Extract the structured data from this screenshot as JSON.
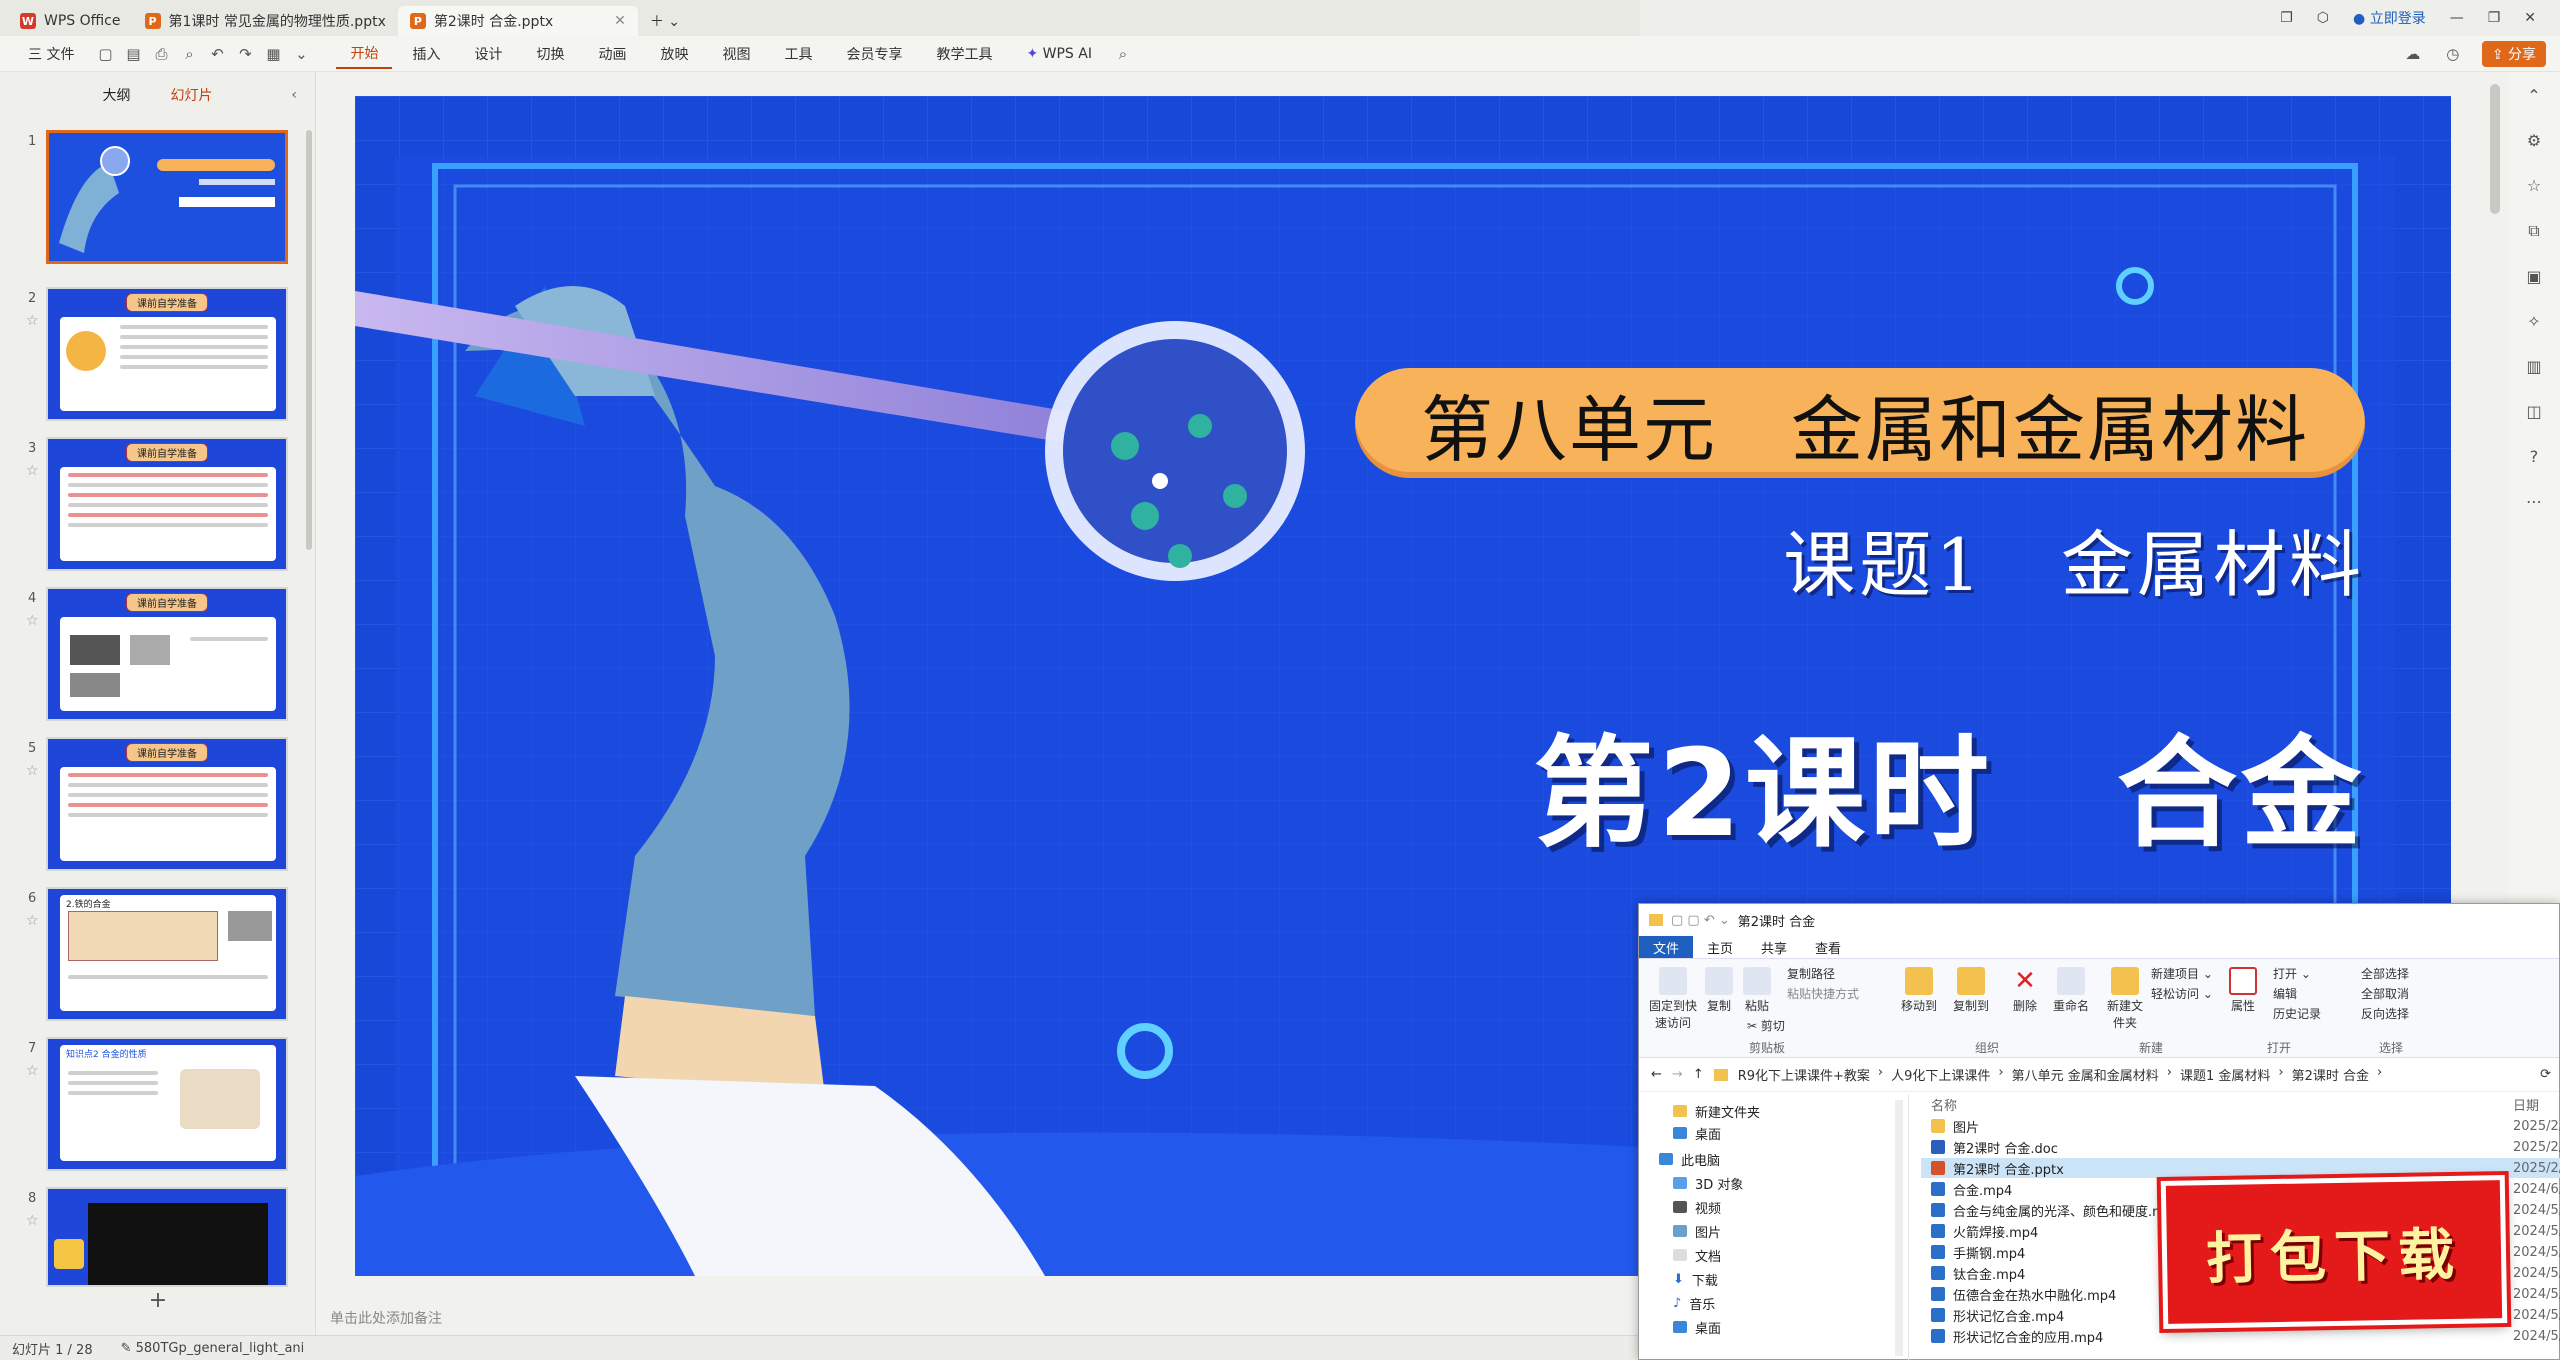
{
  "tabs": [
    {
      "label": "WPS Office",
      "badge": "W",
      "color": "#d23b2a"
    },
    {
      "label": "第1课时 常见金属的物理性质.pptx",
      "badge": "P",
      "color": "#e0681a"
    },
    {
      "label": "第2课时 合金.pptx",
      "badge": "P",
      "color": "#e0681a"
    }
  ],
  "window": {
    "login": "立即登录",
    "share": "分享"
  },
  "menu": {
    "file": "三 文件",
    "items": [
      "开始",
      "插入",
      "设计",
      "切换",
      "动画",
      "放映",
      "视图",
      "工具",
      "会员专享",
      "教学工具"
    ],
    "ai": "WPS AI"
  },
  "panel": {
    "tab_outline": "大纲",
    "tab_slides": "幻灯片",
    "add": "+"
  },
  "thumbs": [
    {
      "num": "1",
      "title": "第八单元 金属和金属材料"
    },
    {
      "num": "2",
      "title": "课前自学准备"
    },
    {
      "num": "3",
      "title": "课前自学准备"
    },
    {
      "num": "4",
      "title": "课前自学准备"
    },
    {
      "num": "5",
      "title": "课前自学准备"
    },
    {
      "num": "6",
      "title": "2.铁的合金"
    },
    {
      "num": "7",
      "title": "知识点2 合金的性质"
    },
    {
      "num": "8",
      "title": ""
    }
  ],
  "slide": {
    "unit_banner": "第八单元　金属和金属材料",
    "topic": "课题1　金属材料",
    "lesson": "第2课时　合金",
    "colors": {
      "bg": "#1848d8",
      "banner": "#f7b25a",
      "glove": "#6fa0c8"
    }
  },
  "notes": "单击此处添加备注",
  "status": {
    "slide": "幻灯片 1 / 28",
    "theme": "580TGp_general_light_ani"
  },
  "explorer": {
    "title": "第2课时 合金",
    "ribbon_tabs": [
      "文件",
      "主页",
      "共享",
      "查看"
    ],
    "ribbon": {
      "pin": "固定到快速访问",
      "copy": "复制",
      "paste": "粘贴",
      "copy_path": "复制路径",
      "paste_shortcut": "粘贴快捷方式",
      "cut": "剪切",
      "move_to": "移动到",
      "copy_to": "复制到",
      "delete": "删除",
      "rename": "重命名",
      "new_folder": "新建文件夹",
      "new_item": "新建项目",
      "easy_access": "轻松访问",
      "properties": "属性",
      "open": "打开",
      "edit": "编辑",
      "history": "历史记录",
      "select_all": "全部选择",
      "select_none": "全部取消",
      "invert": "反向选择",
      "groups": [
        "剪贴板",
        "组织",
        "新建",
        "打开",
        "选择"
      ]
    },
    "breadcrumb": [
      "R9化下上课课件+教案",
      "人9化下上课课件",
      "第八单元 金属和金属材料",
      "课题1 金属材料",
      "第2课时 合金"
    ],
    "nav": [
      "新建文件夹",
      "桌面",
      "此电脑",
      "3D 对象",
      "视频",
      "图片",
      "文档",
      "下载",
      "音乐",
      "桌面"
    ],
    "columns": {
      "name": "名称",
      "date": "日期"
    },
    "files": [
      {
        "name": "图片",
        "date": "2025/2/",
        "type": "folder"
      },
      {
        "name": "第2课时 合金.doc",
        "date": "2025/2/",
        "type": "doc"
      },
      {
        "name": "第2课时 合金.pptx",
        "date": "2025/2/",
        "type": "ppt"
      },
      {
        "name": "合金.mp4",
        "date": "2024/6/",
        "type": "mp4"
      },
      {
        "name": "合金与纯金属的光泽、颜色和硬度.mp4",
        "date": "2024/5/",
        "type": "mp4"
      },
      {
        "name": "火箭焊接.mp4",
        "date": "2024/5/",
        "type": "mp4"
      },
      {
        "name": "手撕钢.mp4",
        "date": "2024/5/",
        "type": "mp4"
      },
      {
        "name": "钛合金.mp4",
        "date": "2024/5/",
        "type": "mp4"
      },
      {
        "name": "伍德合金在热水中融化.mp4",
        "date": "2024/5/",
        "type": "mp4"
      },
      {
        "name": "形状记忆合金.mp4",
        "date": "2024/5/",
        "type": "mp4"
      },
      {
        "name": "形状记忆合金的应用.mp4",
        "date": "2024/5/",
        "type": "mp4"
      }
    ]
  },
  "download_badge": "打包下载"
}
